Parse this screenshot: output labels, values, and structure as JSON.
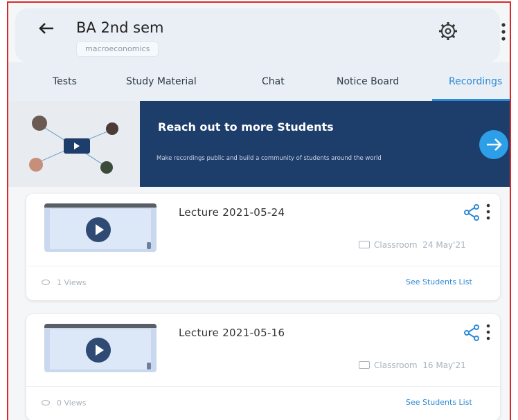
{
  "header": {
    "title": "BA 2nd sem",
    "subject_chip": "macroeconomics",
    "icons": [
      "back-arrow-icon",
      "gear-icon",
      "more-vertical-icon"
    ]
  },
  "tabs": [
    {
      "label": "Tests",
      "active": false
    },
    {
      "label": "Study Material",
      "active": false
    },
    {
      "label": "Chat",
      "active": false
    },
    {
      "label": "Notice Board",
      "active": false
    },
    {
      "label": "Recordings",
      "active": true
    }
  ],
  "banner": {
    "title": "Reach out to more Students",
    "subtitle": "Make recordings public and build a community of students around the world"
  },
  "recordings": [
    {
      "title": "Lecture 2021-05-24",
      "classroom_label": "Classroom",
      "date": "24 May'21",
      "views": "1 Views",
      "students_link": "See Students List"
    },
    {
      "title": "Lecture 2021-05-16",
      "classroom_label": "Classroom",
      "date": "16 May'21",
      "views": "0 Views",
      "students_link": "See Students List"
    }
  ],
  "colors": {
    "accent": "#2d8ad6",
    "banner_bg": "#1d3d6a",
    "header_bg": "#e9eff5",
    "frame_border": "#d9262b"
  }
}
